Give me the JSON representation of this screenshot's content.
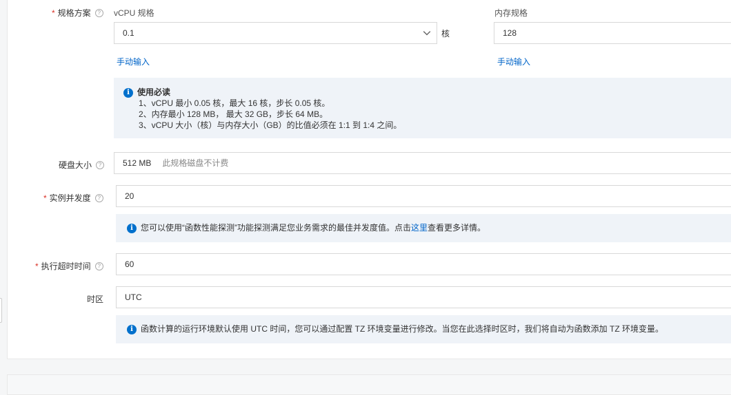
{
  "spec": {
    "label": "规格方案",
    "vcpu_label": "vCPU 规格",
    "vcpu_value": "0.1",
    "vcpu_unit": "核",
    "memory_label": "内存规格",
    "memory_value": "128",
    "manual_input_cpu": "手动输入",
    "manual_input_mem": "手动输入"
  },
  "must_read": {
    "title": "使用必读",
    "lines": [
      "1、vCPU 最小 0.05 核，最大 16 核，步长 0.05 核。",
      "2、内存最小 128 MB， 最大 32 GB，步长 64 MB。",
      "3、vCPU 大小（核）与内存大小（GB）的比值必须在 1:1 到 1:4 之间。"
    ]
  },
  "disk": {
    "label": "硬盘大小",
    "value": "512 MB",
    "note": "此规格磁盘不计费"
  },
  "concurrency": {
    "label": "实例并发度",
    "value": "20",
    "tip_before": "您可以使用“函数性能探测”功能探测满足您业务需求的最佳并发度值。点击",
    "tip_link": "这里",
    "tip_after": "查看更多详情。"
  },
  "timeout": {
    "label": "执行超时时间",
    "value": "60"
  },
  "timezone": {
    "label": "时区",
    "value": "UTC",
    "tip": "函数计算的运行环境默认使用 UTC 时间，您可以通过配置 TZ 环境变量进行修改。当您在此选择时区时，我们将自动为函数添加 TZ 环境变量。"
  },
  "icons": {
    "help": "question-circle-icon",
    "info": "info-circle-icon",
    "dropdown": "chevron-down-icon"
  },
  "colors": {
    "required": "#d93026",
    "link": "#0064c8",
    "info": "#0070cc",
    "note_bg": "#eff3f8"
  }
}
